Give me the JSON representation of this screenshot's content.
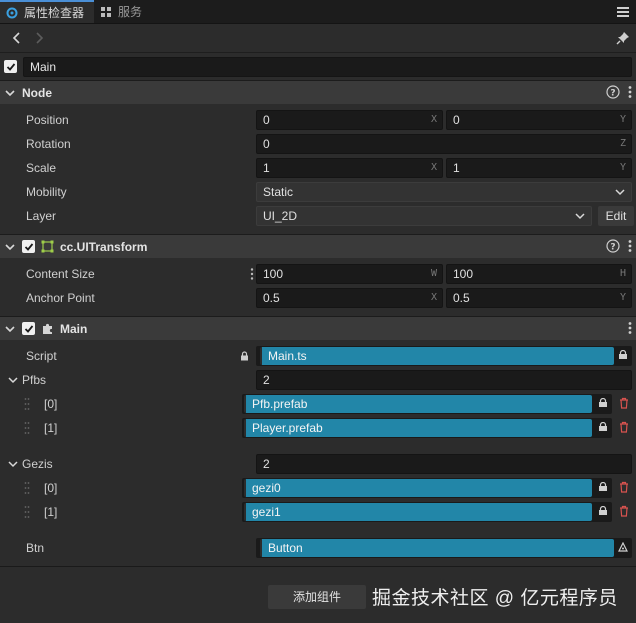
{
  "tabs": [
    {
      "label": "属性检查器",
      "icon": "inspector-gear-icon",
      "active": true
    },
    {
      "label": "服务",
      "icon": "services-grid-icon",
      "active": false
    }
  ],
  "node": {
    "name": "Main",
    "enabled": true
  },
  "sections": {
    "node": {
      "title": "Node",
      "position": {
        "x": "0",
        "y": "0",
        "x_axis": "X",
        "y_axis": "Y"
      },
      "rotation": {
        "z": "0",
        "axis": "Z"
      },
      "scale": {
        "x": "1",
        "y": "1",
        "x_axis": "X",
        "y_axis": "Y"
      },
      "mobility": "Static",
      "layer": "UI_2D",
      "edit_label": "Edit",
      "labels": {
        "position": "Position",
        "rotation": "Rotation",
        "scale": "Scale",
        "mobility": "Mobility",
        "layer": "Layer"
      }
    },
    "uitransform": {
      "title": "cc.UITransform",
      "content_size": {
        "w": "100",
        "h": "100",
        "w_axis": "W",
        "h_axis": "H"
      },
      "anchor_point": {
        "x": "0.5",
        "y": "0.5",
        "x_axis": "X",
        "y_axis": "Y"
      },
      "labels": {
        "content_size": "Content Size",
        "anchor_point": "Anchor Point"
      }
    },
    "main": {
      "title": "Main",
      "script_label": "Script",
      "script": "Main.ts",
      "pfbs_label": "Pfbs",
      "pfbs_count": "2",
      "pfbs": [
        {
          "index": "[0]",
          "value": "Pfb.prefab"
        },
        {
          "index": "[1]",
          "value": "Player.prefab"
        }
      ],
      "gezis_label": "Gezis",
      "gezis_count": "2",
      "gezis": [
        {
          "index": "[0]",
          "value": "gezi0"
        },
        {
          "index": "[1]",
          "value": "gezi1"
        }
      ],
      "btn_label": "Btn",
      "btn": "Button"
    }
  },
  "footer": {
    "add_component": "添加组件"
  },
  "watermark": "掘金技术社区 @ 亿元程序员",
  "colors": {
    "accent": "#2286a8",
    "delete": "#d9534f",
    "tab_active_border": "#4a8fd6"
  }
}
